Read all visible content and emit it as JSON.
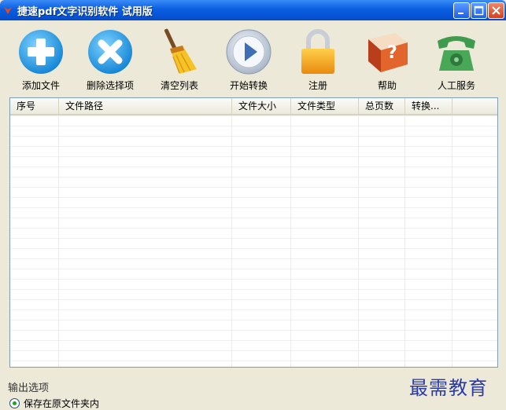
{
  "window": {
    "title": "捷速pdf文字识别软件 试用版"
  },
  "toolbar": {
    "items": [
      {
        "label": "添加文件",
        "icon": "add-icon"
      },
      {
        "label": "删除选择项",
        "icon": "delete-icon"
      },
      {
        "label": "清空列表",
        "icon": "broom-icon"
      },
      {
        "label": "开始转换",
        "icon": "play-icon"
      },
      {
        "label": "注册",
        "icon": "lock-icon"
      },
      {
        "label": "帮助",
        "icon": "help-book-icon"
      },
      {
        "label": "人工服务",
        "icon": "phone-icon"
      }
    ]
  },
  "table": {
    "columns": [
      "序号",
      "文件路径",
      "文件大小",
      "文件类型",
      "总页数",
      "转换..."
    ],
    "rows": []
  },
  "output": {
    "section_label": "输出选项",
    "selected_option": "保存在原文件夹内"
  },
  "watermark": "最需教育",
  "colors": {
    "titlebar": "#0a5ee0",
    "window_bg": "#ece9d8",
    "add_blue": "#29a7e8",
    "lock_orange": "#f3a41a",
    "phone_green": "#3f9b4d"
  }
}
